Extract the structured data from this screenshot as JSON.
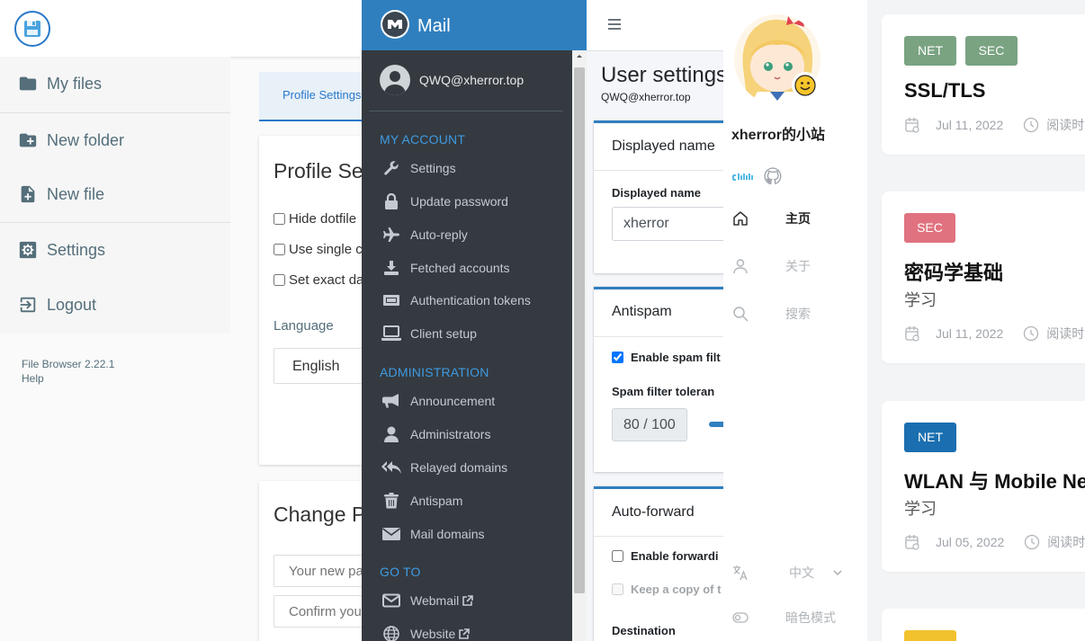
{
  "file_browser": {
    "sidebar": {
      "items": [
        {
          "label": "My files",
          "icon": "folder-icon"
        },
        {
          "label": "New folder",
          "icon": "create-folder-icon"
        },
        {
          "label": "New file",
          "icon": "note-add-icon"
        },
        {
          "label": "Settings",
          "icon": "settings-icon"
        },
        {
          "label": "Logout",
          "icon": "exit-icon"
        }
      ],
      "footer_version": "File Browser 2.22.1",
      "footer_help": "Help"
    },
    "tab_profile": "Profile Settings",
    "profile_card": {
      "title": "Profile Se",
      "checkboxes": [
        "Hide dotfile",
        "Use single c",
        "Set exact da"
      ],
      "language_label": "Language",
      "language_value": "English"
    },
    "password_card": {
      "title": "Change P",
      "new_password_placeholder": "Your new pa",
      "confirm_placeholder": "Confirm you"
    },
    "accent_color": "#2979c9"
  },
  "mail": {
    "brand": "Mail",
    "user": "QWQ@xherror.top",
    "sections": [
      {
        "header": "MY ACCOUNT",
        "items": [
          "Settings",
          "Update password",
          "Auto-reply",
          "Fetched accounts",
          "Authentication tokens",
          "Client setup"
        ]
      },
      {
        "header": "ADMINISTRATION",
        "items": [
          "Announcement",
          "Administrators",
          "Relayed domains",
          "Antispam",
          "Mail domains"
        ]
      },
      {
        "header": "GO TO",
        "items": [
          "Webmail",
          "Website"
        ]
      }
    ],
    "header_color": "#2f7fbf",
    "sidebar_color": "#343a40"
  },
  "user_settings": {
    "title": "User settings",
    "email": "QWQ@xherror.top",
    "displayed_name_card": {
      "title": "Displayed name",
      "label": "Displayed name",
      "value": "xherror"
    },
    "antispam_card": {
      "title": "Antispam",
      "enable_label": "Enable spam filt",
      "tolerance_label": "Spam filter toleran",
      "tolerance_value": "80 / 100"
    },
    "autoforward_card": {
      "title": "Auto-forward",
      "enable_label": "Enable forwardi",
      "keep_copy_label": "Keep a copy of t",
      "destination_label": "Destination"
    }
  },
  "blog": {
    "site_name": "xherror的小站",
    "nav": [
      {
        "label": "主页",
        "icon": "home-icon",
        "active": true
      },
      {
        "label": "关于",
        "icon": "user-icon",
        "active": false
      },
      {
        "label": "搜索",
        "icon": "search-icon",
        "active": false
      }
    ],
    "language": "中文",
    "dark_mode_label": "暗色模式",
    "posts": [
      {
        "tags": [
          {
            "name": "NET",
            "color": "#7aa382"
          },
          {
            "name": "SEC",
            "color": "#7aa382"
          }
        ],
        "title": "SSL/TLS",
        "subtitle": "",
        "date": "Jul 11, 2022",
        "read_time": "阅读时"
      },
      {
        "tags": [
          {
            "name": "SEC",
            "color": "#e0727f"
          }
        ],
        "title": "密码学基础",
        "subtitle": "学习",
        "date": "Jul 11, 2022",
        "read_time": "阅读时"
      },
      {
        "tags": [
          {
            "name": "NET",
            "color": "#1b6fb0"
          }
        ],
        "title": "WLAN 与 Mobile Net",
        "subtitle": "学习",
        "date": "Jul 05, 2022",
        "read_time": "阅读时"
      }
    ],
    "next_tag_color": "#f2c12e"
  }
}
